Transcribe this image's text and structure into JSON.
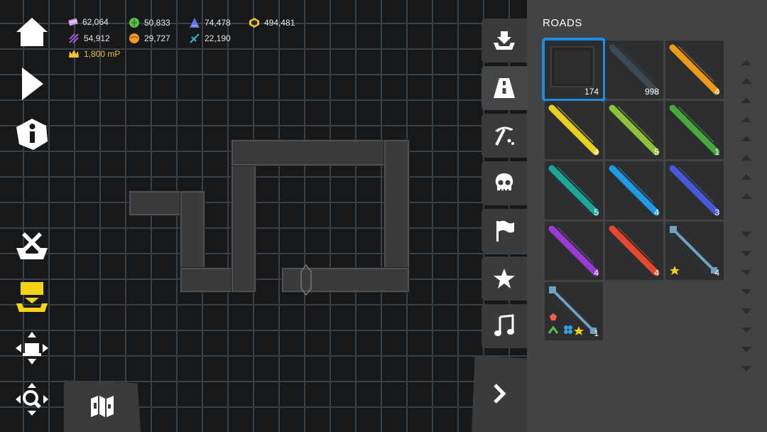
{
  "resources": [
    {
      "icon": "striped-gem-icon",
      "value": "62,064",
      "color": "#c9a0e6"
    },
    {
      "icon": "green-orb-icon",
      "value": "50,833",
      "color": "#5ec04a"
    },
    {
      "icon": "blue-triangle-icon",
      "value": "74,478",
      "color": "#5a78e6"
    },
    {
      "icon": "gold-coin-icon",
      "value": "494,481",
      "color": "#f1c232"
    },
    {
      "icon": "purple-stripes-icon",
      "value": "54,912",
      "color": "#a05ad6"
    },
    {
      "icon": "orange-orb-icon",
      "value": "29,727",
      "color": "#f29a2e"
    },
    {
      "icon": "cyan-crystal-icon",
      "value": "22,190",
      "color": "#2fb8d6"
    }
  ],
  "crown": {
    "icon": "crown-icon",
    "value": "1,800 mP",
    "color": "#f1c232"
  },
  "left_buttons": [
    "home-icon",
    "play-icon",
    "info-icon",
    "clear-icon",
    "layer-icon",
    "move-icon",
    "zoom-icon"
  ],
  "bottom_button": "map-icon",
  "categories": [
    "download-icon",
    "road-icon",
    "pickaxe-icon",
    "skull-icon",
    "flag-icon",
    "star-icon",
    "music-icon"
  ],
  "active_category": "road-icon",
  "expand_button": "chevron-right-icon",
  "panel": {
    "title": "ROADS",
    "tiles": [
      {
        "count": "174",
        "color": "#2e2e2e",
        "kind": "block",
        "selected": true
      },
      {
        "count": "998",
        "color": "#3c4a55",
        "kind": "stripe"
      },
      {
        "count": "4",
        "color": "#f09a1a",
        "kind": "stripe"
      },
      {
        "count": "4",
        "color": "#e6d21e",
        "kind": "stripe"
      },
      {
        "count": "5",
        "color": "#8fc23a",
        "kind": "stripe"
      },
      {
        "count": "1",
        "color": "#44a83c",
        "kind": "stripe"
      },
      {
        "count": "5",
        "color": "#1aa89a",
        "kind": "stripe"
      },
      {
        "count": "4",
        "color": "#1e9ae6",
        "kind": "stripe"
      },
      {
        "count": "3",
        "color": "#4a5ad6",
        "kind": "stripe"
      },
      {
        "count": "4",
        "color": "#9a3ad6",
        "kind": "stripe"
      },
      {
        "count": "4",
        "color": "#e64a2e",
        "kind": "stripe"
      },
      {
        "count": "4",
        "color": "#6fa2c2",
        "kind": "pole"
      },
      {
        "count": "1",
        "color": "#6fa2c2",
        "kind": "pole"
      }
    ]
  }
}
